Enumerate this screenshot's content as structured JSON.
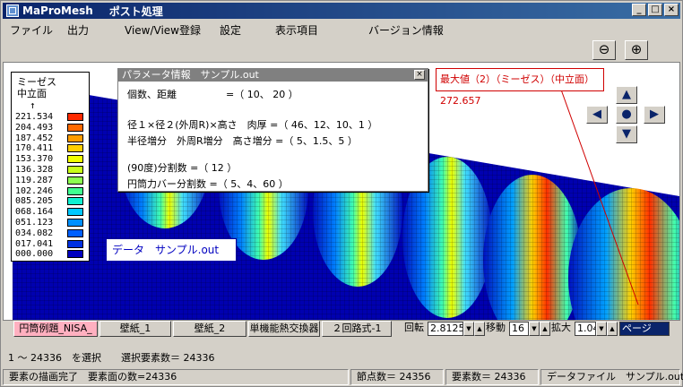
{
  "window": {
    "title": "MaProMesh",
    "subtitle": "ポスト処理",
    "minimize": "_",
    "maximize": "□",
    "close": "×"
  },
  "menu": [
    "ファイル",
    "出力",
    "View/View登録",
    "設定",
    "表示項目",
    "バージョン情報"
  ],
  "toolbar": {
    "zoom_out": "⊖",
    "zoom_in": "⊕"
  },
  "legend": {
    "title1": "ミーゼス",
    "title2": "中立面",
    "arrow": "↑",
    "values": [
      "221.534",
      "204.493",
      "187.452",
      "170.411",
      "153.370",
      "136.328",
      "119.287",
      "102.246",
      "085.205",
      "068.164",
      "051.123",
      "034.082",
      "017.041",
      "000.000"
    ],
    "colors": [
      "#ff2a00",
      "#ff6a00",
      "#ff9c00",
      "#ffcf00",
      "#f0ff00",
      "#c8ff1a",
      "#8cff50",
      "#3fff90",
      "#10f0d0",
      "#00c8ff",
      "#0090ff",
      "#0060ff",
      "#0030e0",
      "#0000c0"
    ]
  },
  "param": {
    "title": "パラメータ情報　サンプル.out",
    "close": "×",
    "lines": [
      "個数、距離　　　　　=（ 10、 20 ）",
      "",
      "径１×径２(外周R)×高さ　肉厚 =（ 46、12、10、1 ）",
      "半径増分　外周R増分　高さ増分 =（ 5、1.5、5 ）",
      "",
      "(90度)分割数 =（ 12 ）",
      "円筒力バー分割数 =（ 5、4、60 ）"
    ]
  },
  "max_label": "最大値（2）（ミーゼス）（中立面） 272.657",
  "data_label": "データ　サンプル.out",
  "nav": {
    "up": "▲",
    "left": "◀",
    "center": "●",
    "right": "▶",
    "down": "▼"
  },
  "tabs": [
    "円筒例題_NISA_",
    "壁紙_1",
    "壁紙_2",
    "単機能熱交換器",
    "２回路式-1"
  ],
  "controls": {
    "rot_label": "回転",
    "rot_value": "2.8125",
    "move_label": "移動",
    "move_value": "16",
    "zoom_label": "拡大",
    "zoom_value": "1.04",
    "page_label": "ページ"
  },
  "status": {
    "select": "1 ～ 24336　を選択　　選択要素数＝ 24336",
    "done": "要素の描画完了　要素面の数=24336",
    "nodes": "節点数＝ 24356",
    "elements": "要素数＝ 24336",
    "datafile": "データファイル　サンプル.out"
  }
}
